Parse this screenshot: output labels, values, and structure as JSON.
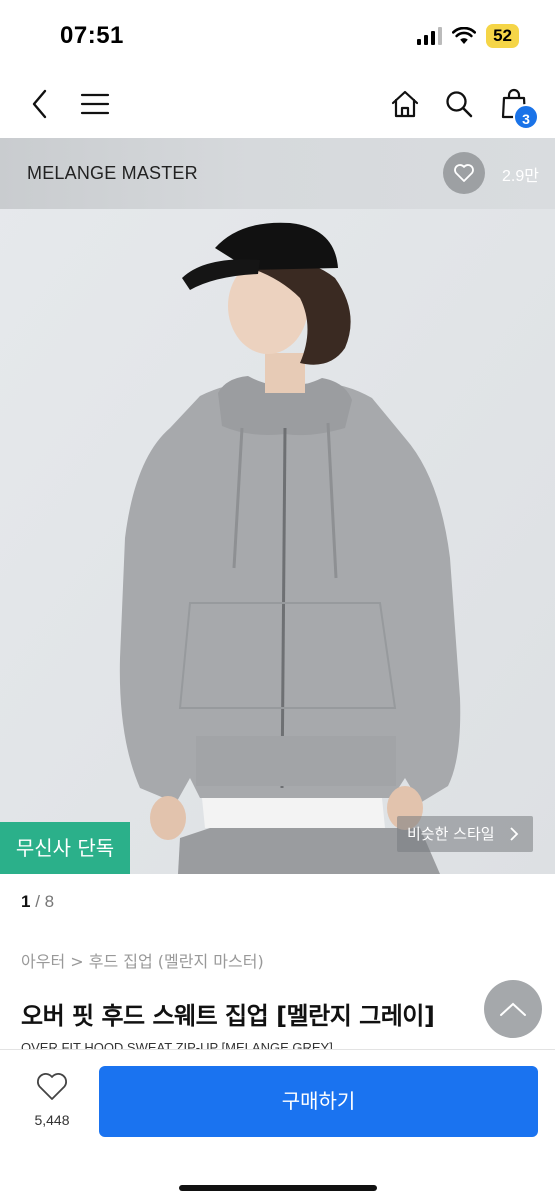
{
  "status_bar": {
    "time": "07:51",
    "battery": "52"
  },
  "nav": {
    "back_icon": "chevron-left-icon",
    "menu_icon": "hamburger-menu-icon",
    "home_icon": "home-icon",
    "search_icon": "search-icon",
    "cart_icon": "shopping-bag-icon",
    "cart_count": "3"
  },
  "product_image": {
    "brand": "MELANGE MASTER",
    "brand_like_count": "2.9만",
    "exclusive_badge": "무신사 단독",
    "similar_style": "비슷한 스타일"
  },
  "gallery": {
    "current": "1",
    "total": "8"
  },
  "product": {
    "breadcrumb": "아우터 > 후드 집업 (멜란지 마스터)",
    "title": "오버 핏 후드 스웨트 집업 [멜란지 그레이]",
    "subtitle": "OVER FIT HOOD SWEAT ZIP-UP [MELANGE GREY]"
  },
  "bottom_bar": {
    "wish_count": "5,448",
    "buy_label": "구매하기"
  },
  "colors": {
    "accent_blue": "#1a73f0",
    "exclusive_green": "#2bb08a",
    "battery_yellow": "#f5d547"
  }
}
